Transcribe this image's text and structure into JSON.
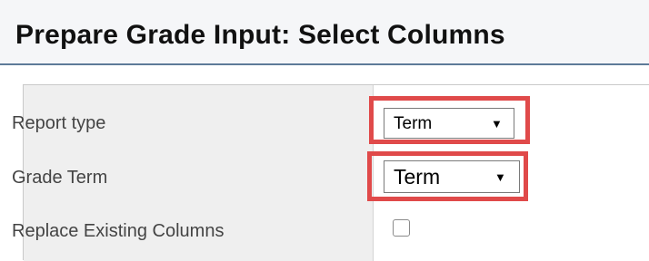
{
  "page": {
    "title": "Prepare Grade Input: Select Columns"
  },
  "form": {
    "rows": [
      {
        "label": "Report type",
        "control": "select",
        "value": "Term",
        "icon": "triangle-down-icon",
        "highlighted": true
      },
      {
        "label": "Grade Term",
        "control": "select",
        "value": "Term",
        "icon": "triangle-down-icon",
        "highlighted": true
      },
      {
        "label": "Replace Existing Columns",
        "control": "checkbox",
        "checked": false
      }
    ]
  },
  "colors": {
    "highlight": "#e04a4a",
    "header_rule": "#5d7a98",
    "label_bg": "#efefef"
  }
}
